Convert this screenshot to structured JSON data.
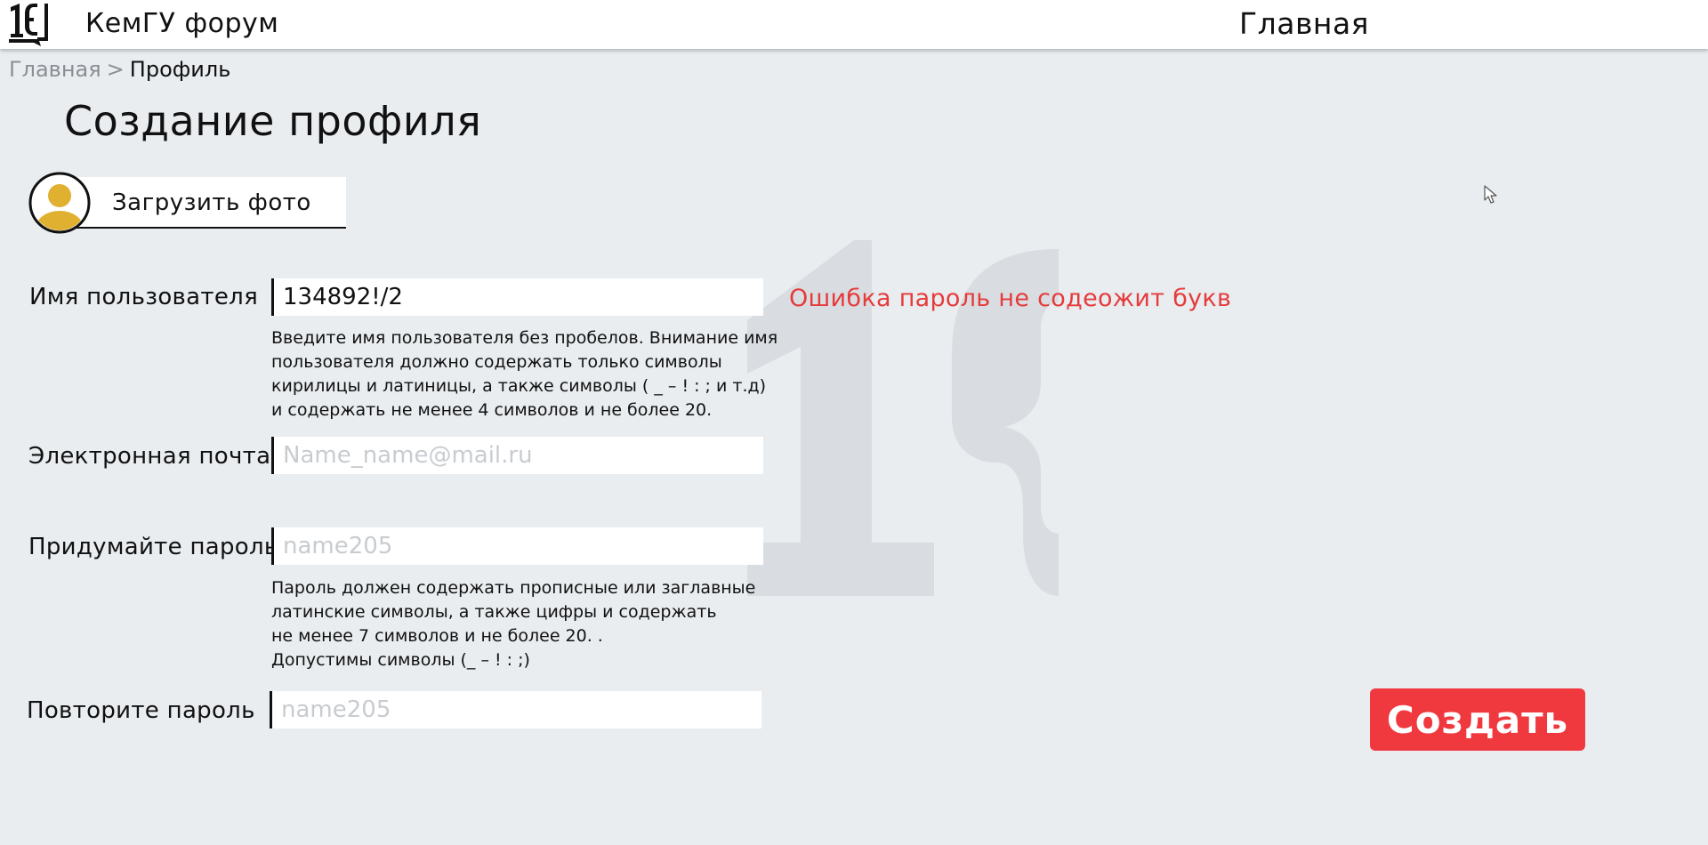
{
  "header": {
    "logo_icon": "kemgu-1k-logo",
    "site_title": "КемГУ форум",
    "nav_main": "Главная"
  },
  "breadcrumb": {
    "home": "Главная",
    "separator": ">",
    "current": "Профиль"
  },
  "page": {
    "title": "Создание профиля"
  },
  "upload": {
    "label": "Загрузить фото",
    "avatar_icon": "user-avatar-icon",
    "avatar_color": "#e0b030"
  },
  "form": {
    "username": {
      "label": "Имя пользователя",
      "value": "134892!/2",
      "hint": [
        "Введите имя пользователя без пробелов. Внимание имя",
        "пользователя должно содержать только символы",
        "кирилицы и латиницы, а также символы ( _   –  !  :  ; и т.д)",
        "и содержать не менее 4 символов и не более 20."
      ]
    },
    "email": {
      "label": "Электронная почта",
      "placeholder": "Name_name@mail.ru"
    },
    "password": {
      "label": "Придумайте пароль",
      "placeholder": "name205",
      "hint": [
        "Пароль должен содержать прописные или заглавные",
        "латинские символы, а также цифры и содержать",
        "не менее 7 символов и не более 20. .",
        "Допустимы символы (_ – ! : ;)"
      ]
    },
    "password_repeat": {
      "label": "Повторите пароль",
      "placeholder": "name205"
    },
    "error": "Ошибка пароль не содеожит букв",
    "error_color": "#e63b3b",
    "submit_label": "Создать",
    "submit_color": "#f0393f"
  }
}
